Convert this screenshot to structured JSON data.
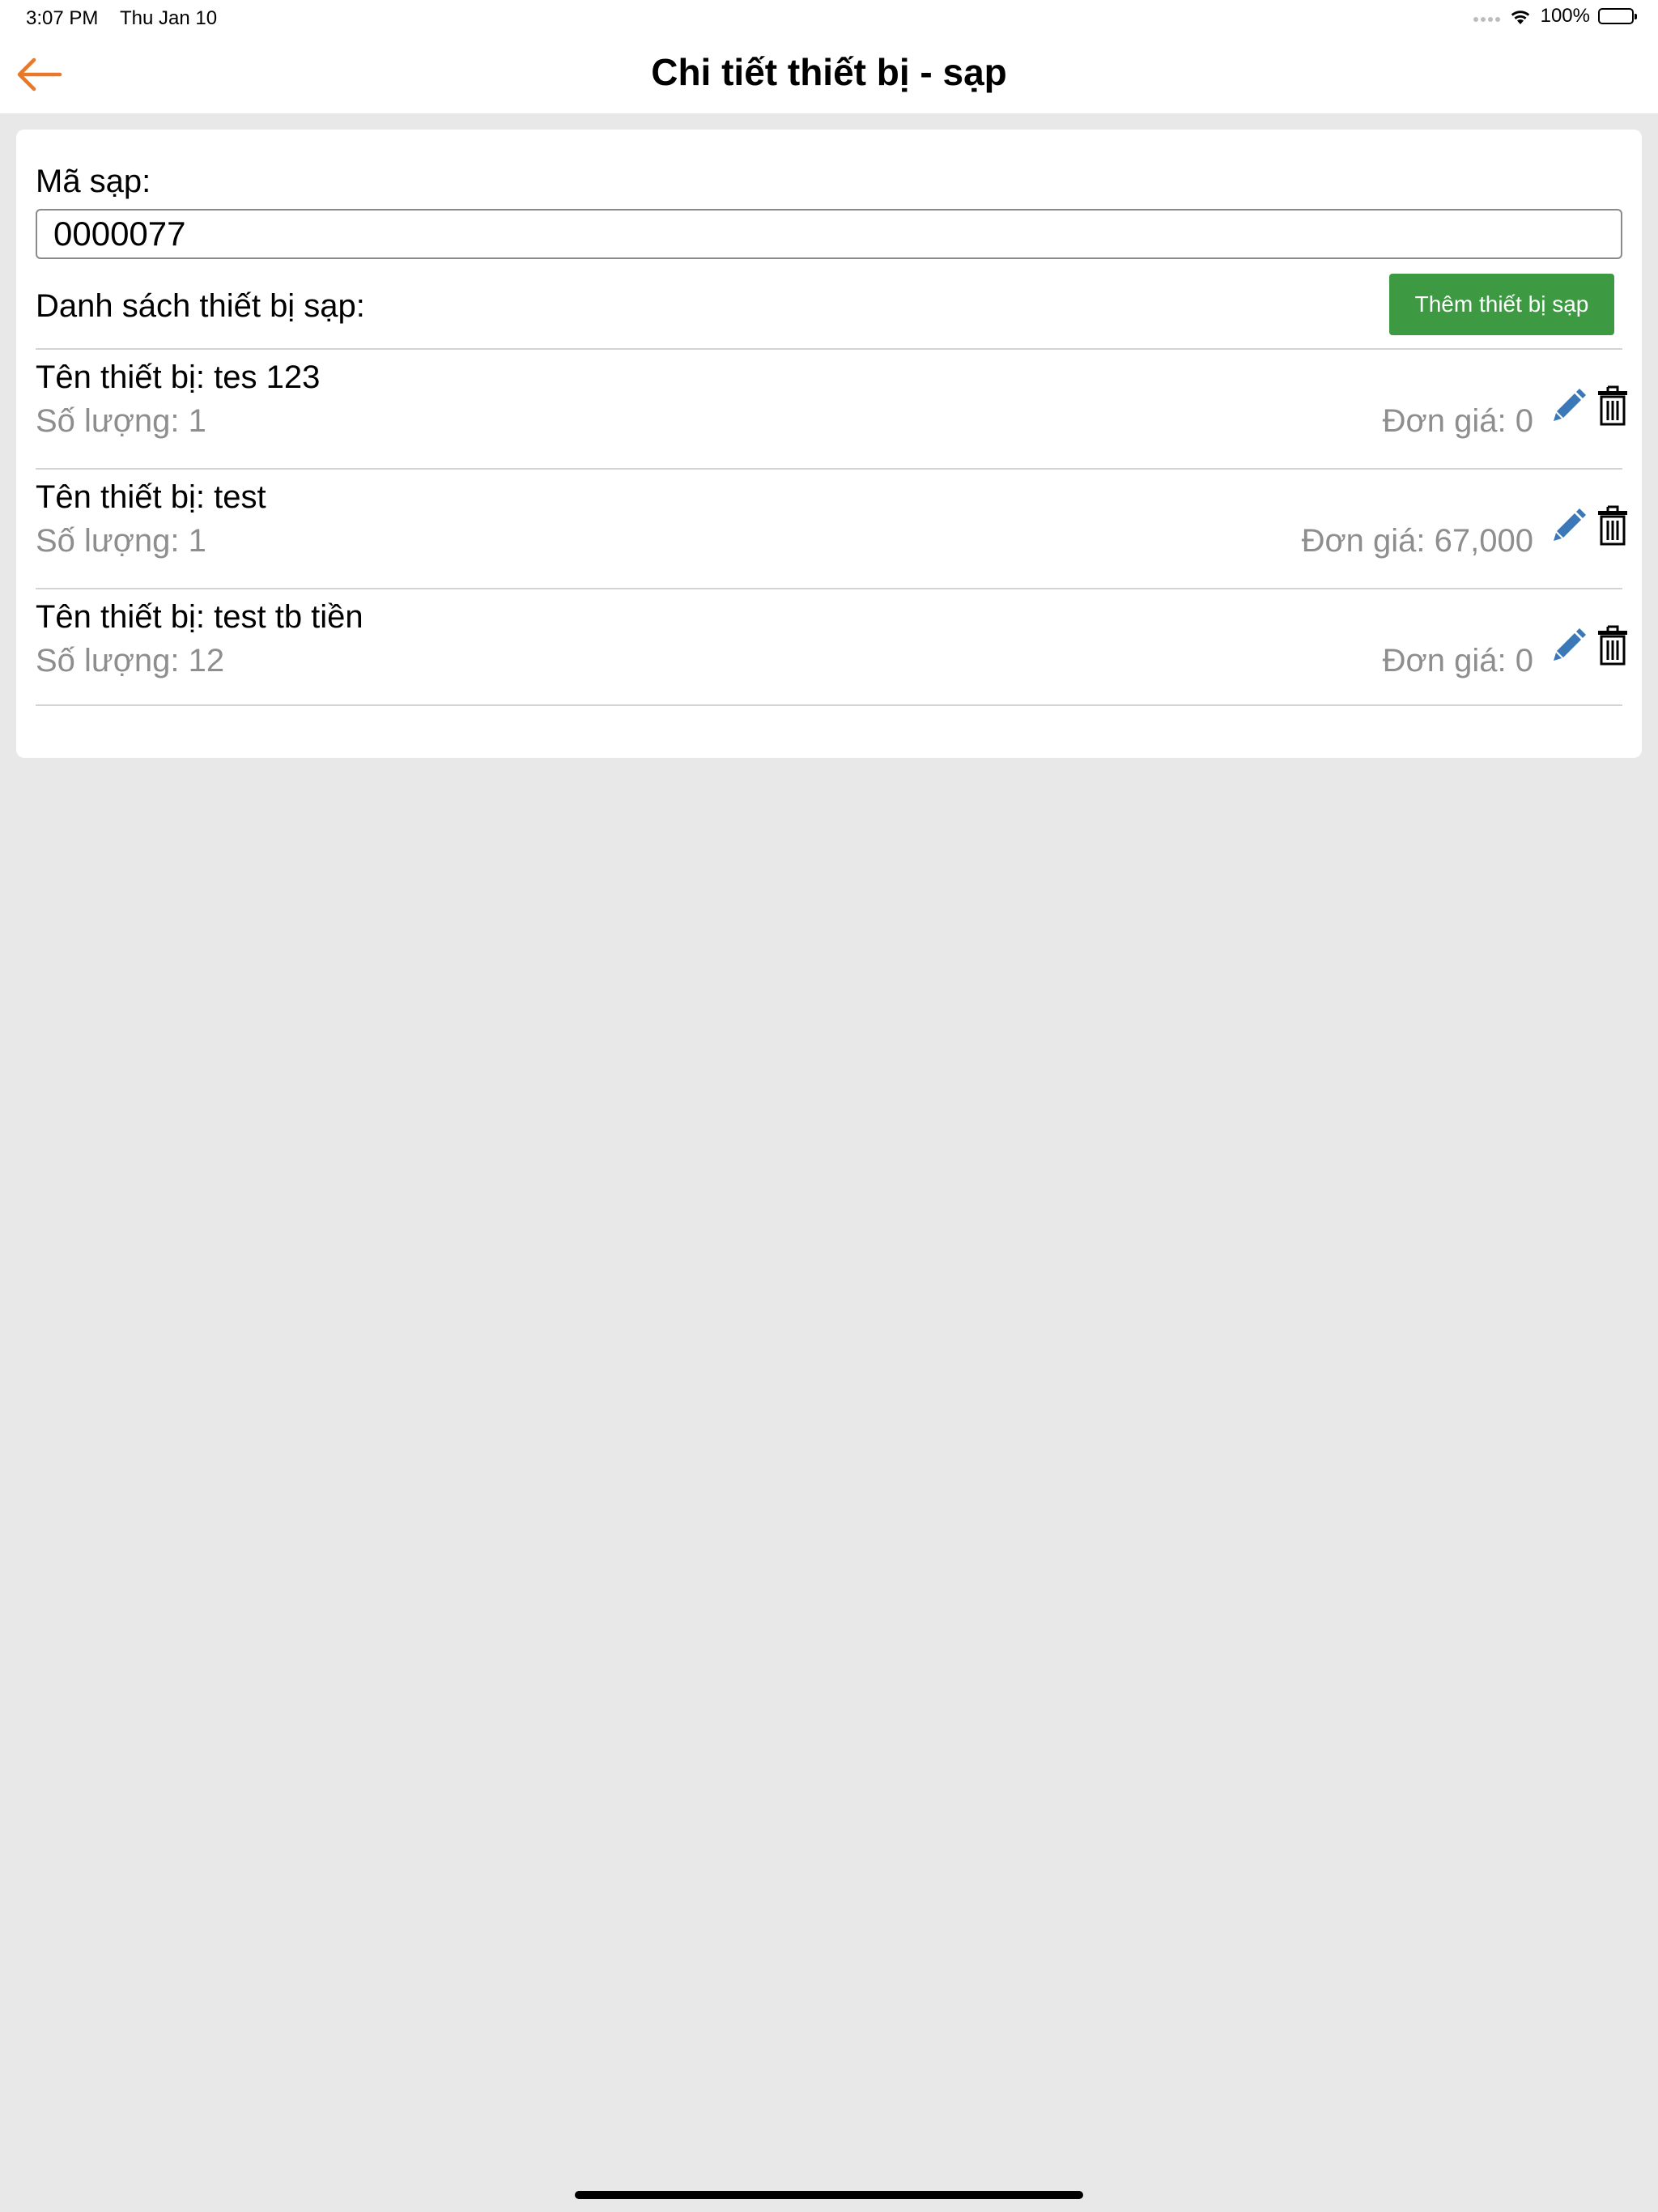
{
  "status_bar": {
    "time": "3:07 PM",
    "date": "Thu Jan 10",
    "battery": "100%",
    "icons": [
      "signal-dots-icon",
      "wifi-icon",
      "battery-icon"
    ]
  },
  "nav": {
    "back_icon": "arrow-left-icon",
    "title": "Chi tiết thiết bị - sạp"
  },
  "colors": {
    "accent_back": "#e8782a",
    "add_button": "#3d9a42",
    "edit_icon": "#3a78b8",
    "background": "#e8e8e8"
  },
  "form": {
    "code_label": "Mã sạp:",
    "code_value": "0000077",
    "list_label": "Danh sách thiết bị sạp:",
    "add_button": "Thêm thiết bị sạp"
  },
  "items": [
    {
      "name": "Tên thiết bị: tes 123",
      "quantity": "Số lượng: 1",
      "price": "Đơn giá: 0"
    },
    {
      "name": "Tên thiết bị: test",
      "quantity": "Số lượng: 1",
      "price": "Đơn giá: 67,000"
    },
    {
      "name": "Tên thiết bị: test tb tiền",
      "quantity": "Số lượng: 12",
      "price": "Đơn giá: 0"
    }
  ]
}
